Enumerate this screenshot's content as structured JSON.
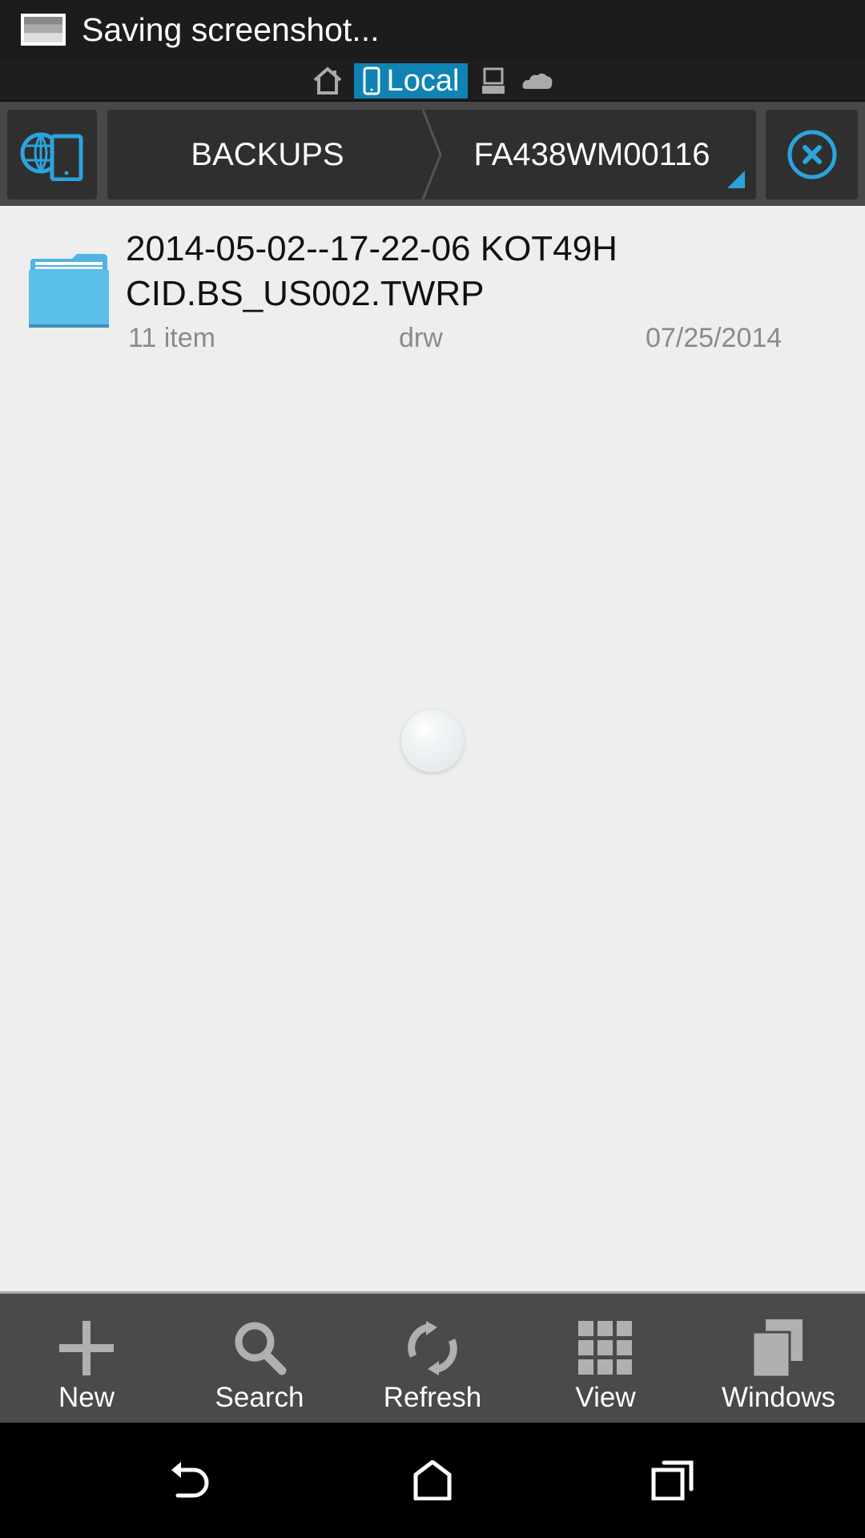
{
  "status_bar": {
    "notification_icon": "screenshot-icon",
    "notification_text": "Saving screenshot..."
  },
  "location_tabs": [
    {
      "icon": "home-icon",
      "label": "",
      "active": false
    },
    {
      "icon": "phone-icon",
      "label": "Local",
      "active": true
    },
    {
      "icon": "computer-icon",
      "label": "",
      "active": false
    },
    {
      "icon": "cloud-icon",
      "label": "",
      "active": false
    }
  ],
  "breadcrumb": {
    "nav_icon": "globe-phone-icon",
    "segments": [
      "BACKUPS",
      "FA438WM00116"
    ],
    "close_icon": "close-circle-icon"
  },
  "files": [
    {
      "name": "2014-05-02--17-22-06 KOT49H CID.BS_US002.TWRP",
      "type": "folder",
      "item_count": "11 item",
      "permissions": "drw",
      "date": "07/25/2014"
    }
  ],
  "toolbar": {
    "items": [
      {
        "icon": "plus-icon",
        "label": "New"
      },
      {
        "icon": "search-icon",
        "label": "Search"
      },
      {
        "icon": "refresh-icon",
        "label": "Refresh"
      },
      {
        "icon": "grid-view-icon",
        "label": "View"
      },
      {
        "icon": "windows-icon",
        "label": "Windows"
      }
    ]
  },
  "nav_bar": {
    "buttons": [
      "back",
      "home",
      "recents"
    ]
  },
  "colors": {
    "accent": "#0f83b4",
    "accent_light": "#2ba4dd",
    "folder": "#5bbfec",
    "toolbar_bg": "#4a4a4a",
    "content_bg": "#eeeeee"
  }
}
